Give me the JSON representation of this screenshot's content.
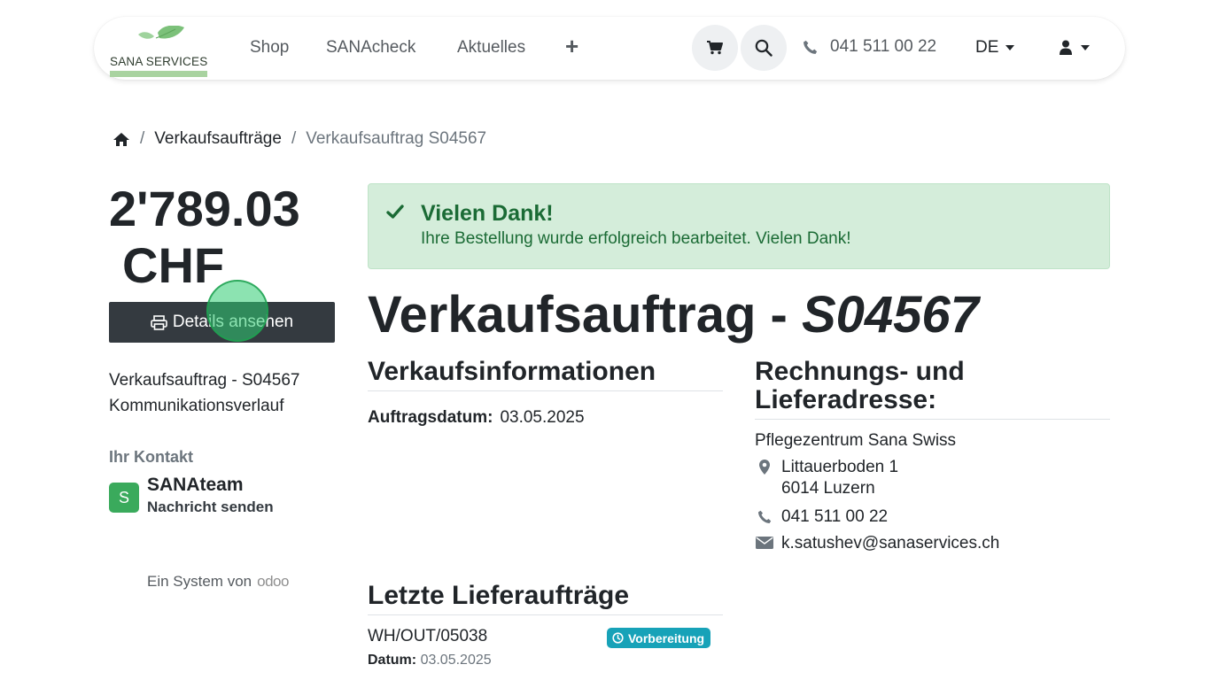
{
  "brand": {
    "name": "SANA SERVICES",
    "accent": "#a9d3a0"
  },
  "nav": {
    "items": [
      "Shop",
      "SANAcheck",
      "Aktuelles"
    ],
    "more_symbol": "+",
    "phone": "041 511 00 22",
    "language": "DE"
  },
  "breadcrumb": {
    "level1": "Verkaufsaufträge",
    "current": "Verkaufsauftrag S04567"
  },
  "sidebar": {
    "amount": "2'789.03",
    "currency": "CHF",
    "details_button": "Details ansehen",
    "links": [
      "Verkaufsauftrag - S04567",
      "Kommunikationsverlauf"
    ],
    "contact_heading": "Ihr Kontakt",
    "contact_initial": "S",
    "contact_name": "SANAteam",
    "contact_action": "Nachricht senden",
    "powered_by": "Ein System von",
    "powered_brand": "odoo"
  },
  "alert": {
    "title": "Vielen Dank!",
    "message": "Ihre Bestellung wurde erfolgreich bearbeitet. Vielen Dank!"
  },
  "order": {
    "title_prefix": "Verkaufsauftrag - ",
    "title_number": "S04567",
    "info_heading": "Verkaufsinformationen",
    "date_label": "Auftragsdatum:",
    "date_value": "03.05.2025"
  },
  "address": {
    "heading": "Rechnungs- und Lieferadresse:",
    "name": "Pflegezentrum Sana Swiss",
    "street": "Littauerboden 1",
    "city": "6014 Luzern",
    "phone": "041 511 00 22",
    "email": "k.satushev@sanaservices.ch"
  },
  "deliveries": {
    "heading": "Letzte Lieferaufträge",
    "items": [
      {
        "ref": "WH/OUT/05038",
        "status": "Vorbereitung",
        "date_label": "Datum:",
        "date": "03.05.2025"
      }
    ]
  }
}
